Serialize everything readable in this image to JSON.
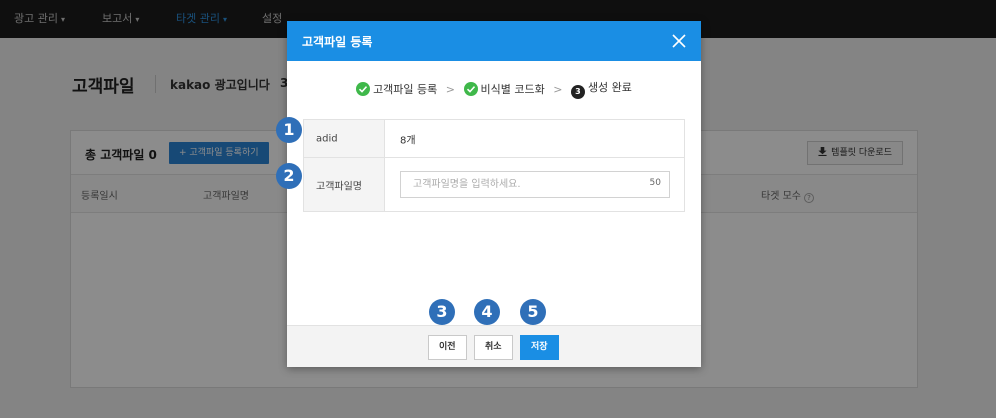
{
  "nav": {
    "items": [
      {
        "label": "광고 관리",
        "caret": "▾",
        "active": false
      },
      {
        "label": "보고서",
        "caret": "▾",
        "active": false
      },
      {
        "label": "타겟 관리",
        "caret": "▾",
        "active": true
      },
      {
        "label": "설정",
        "caret": "",
        "active": false
      }
    ]
  },
  "page": {
    "title": "고객파일",
    "account": "kakao 광고입니다",
    "account_extra": "3"
  },
  "card": {
    "count_label": "총 고객파일 0",
    "add_button": "+  고객파일 등록하기",
    "template_button": "템플릿 다운로드",
    "columns": {
      "registered": "등록일시",
      "filename": "고객파일명",
      "target_count": "타겟 모수"
    },
    "help_icon": "?"
  },
  "modal": {
    "title": "고객파일 등록",
    "close_icon": "close-icon",
    "steps": [
      {
        "label": "고객파일 등록",
        "state": "done"
      },
      {
        "label": "비식별 코드화",
        "state": "done"
      },
      {
        "label": "생성 완료",
        "state": "current",
        "number": "3"
      }
    ],
    "step_separator": ">",
    "form": {
      "adid_label": "adid",
      "adid_value": "8개",
      "name_label": "고객파일명",
      "name_placeholder": "고객파일명을 입력하세요.",
      "name_value": "",
      "name_max": "50"
    },
    "buttons": {
      "prev": "이전",
      "cancel": "취소",
      "save": "저장"
    }
  },
  "callouts": [
    "1",
    "2",
    "3",
    "4",
    "5"
  ],
  "colors": {
    "accent": "#1a8ee4",
    "nav_bg": "#1c1c1c",
    "nav_active": "#2f93e0",
    "step_done": "#3fb84a",
    "callout": "#2f6fb8"
  }
}
